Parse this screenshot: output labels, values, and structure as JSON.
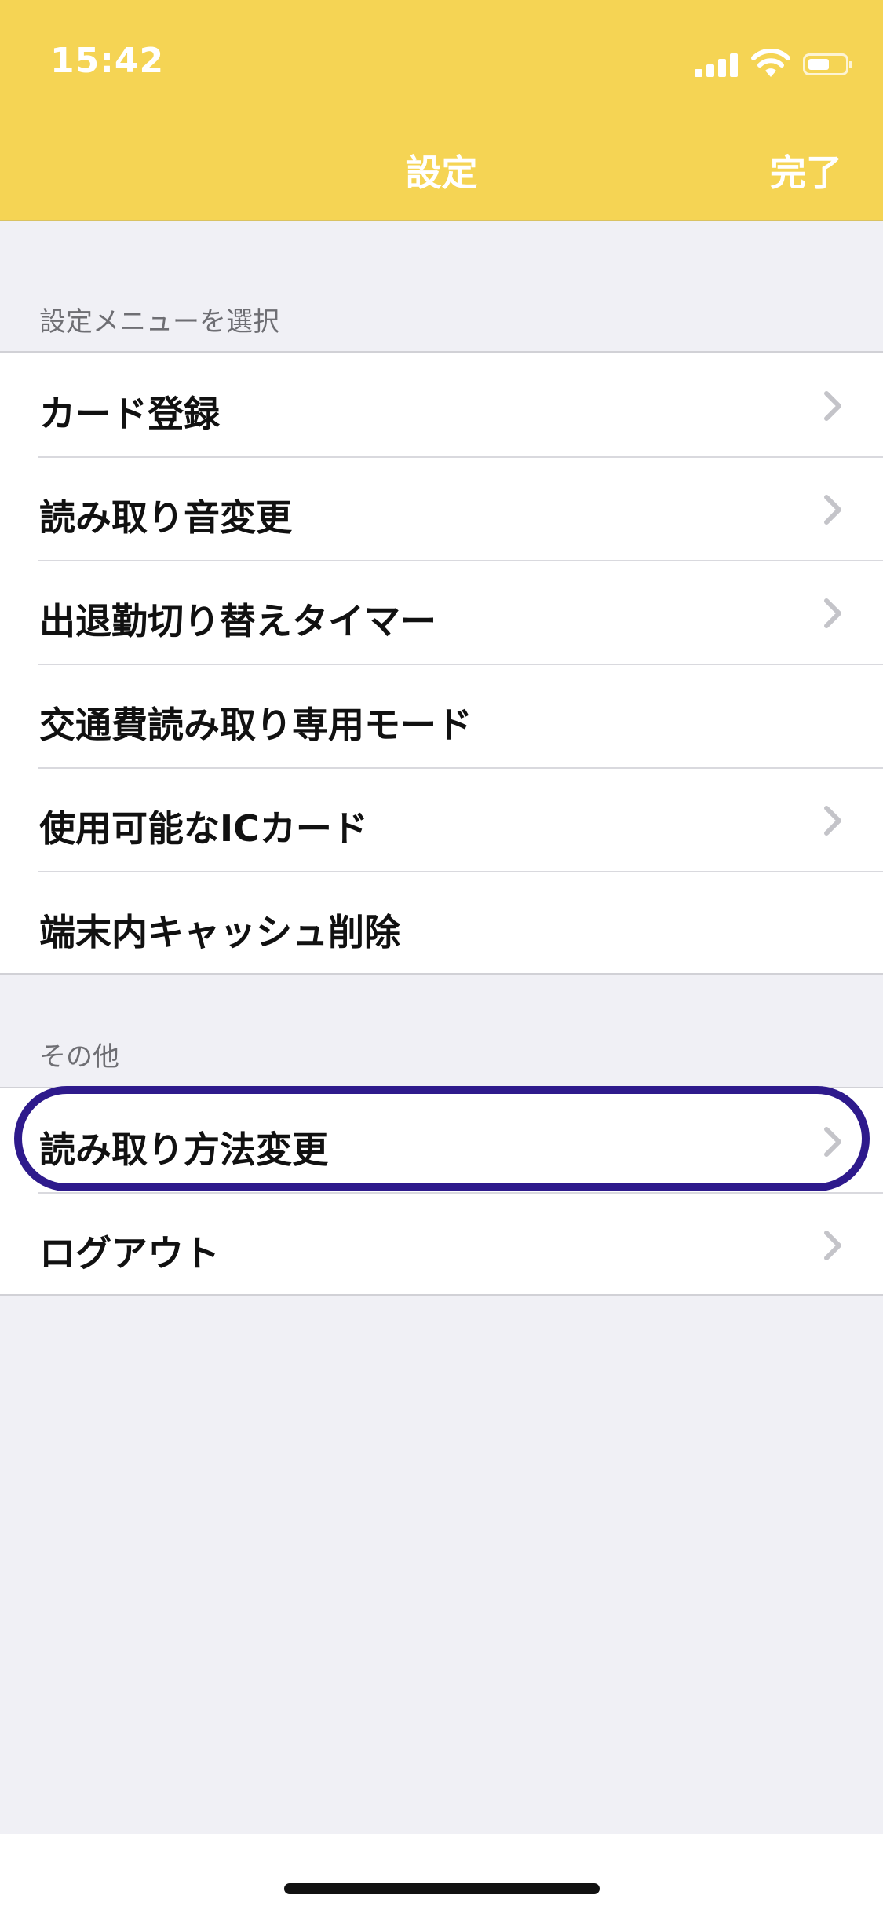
{
  "status_bar": {
    "time": "15:42"
  },
  "nav": {
    "title": "設定",
    "done_label": "完了"
  },
  "sections": [
    {
      "header": "設定メニューを選択",
      "items": [
        {
          "label": "カード登録",
          "chevron": true
        },
        {
          "label": "読み取り音変更",
          "chevron": true
        },
        {
          "label": "出退勤切り替えタイマー",
          "chevron": true
        },
        {
          "label": "交通費読み取り専用モード",
          "chevron": false
        },
        {
          "label": "使用可能なICカード",
          "chevron": true
        },
        {
          "label": "端末内キャッシュ削除",
          "chevron": false
        }
      ]
    },
    {
      "header": "その他",
      "items": [
        {
          "label": "読み取り方法変更",
          "chevron": true,
          "highlighted": true
        },
        {
          "label": "ログアウト",
          "chevron": true
        }
      ]
    }
  ],
  "colors": {
    "header_bg": "#F5D454",
    "highlight_ring": "#2E1A8C",
    "page_bg": "#F0F0F5"
  }
}
